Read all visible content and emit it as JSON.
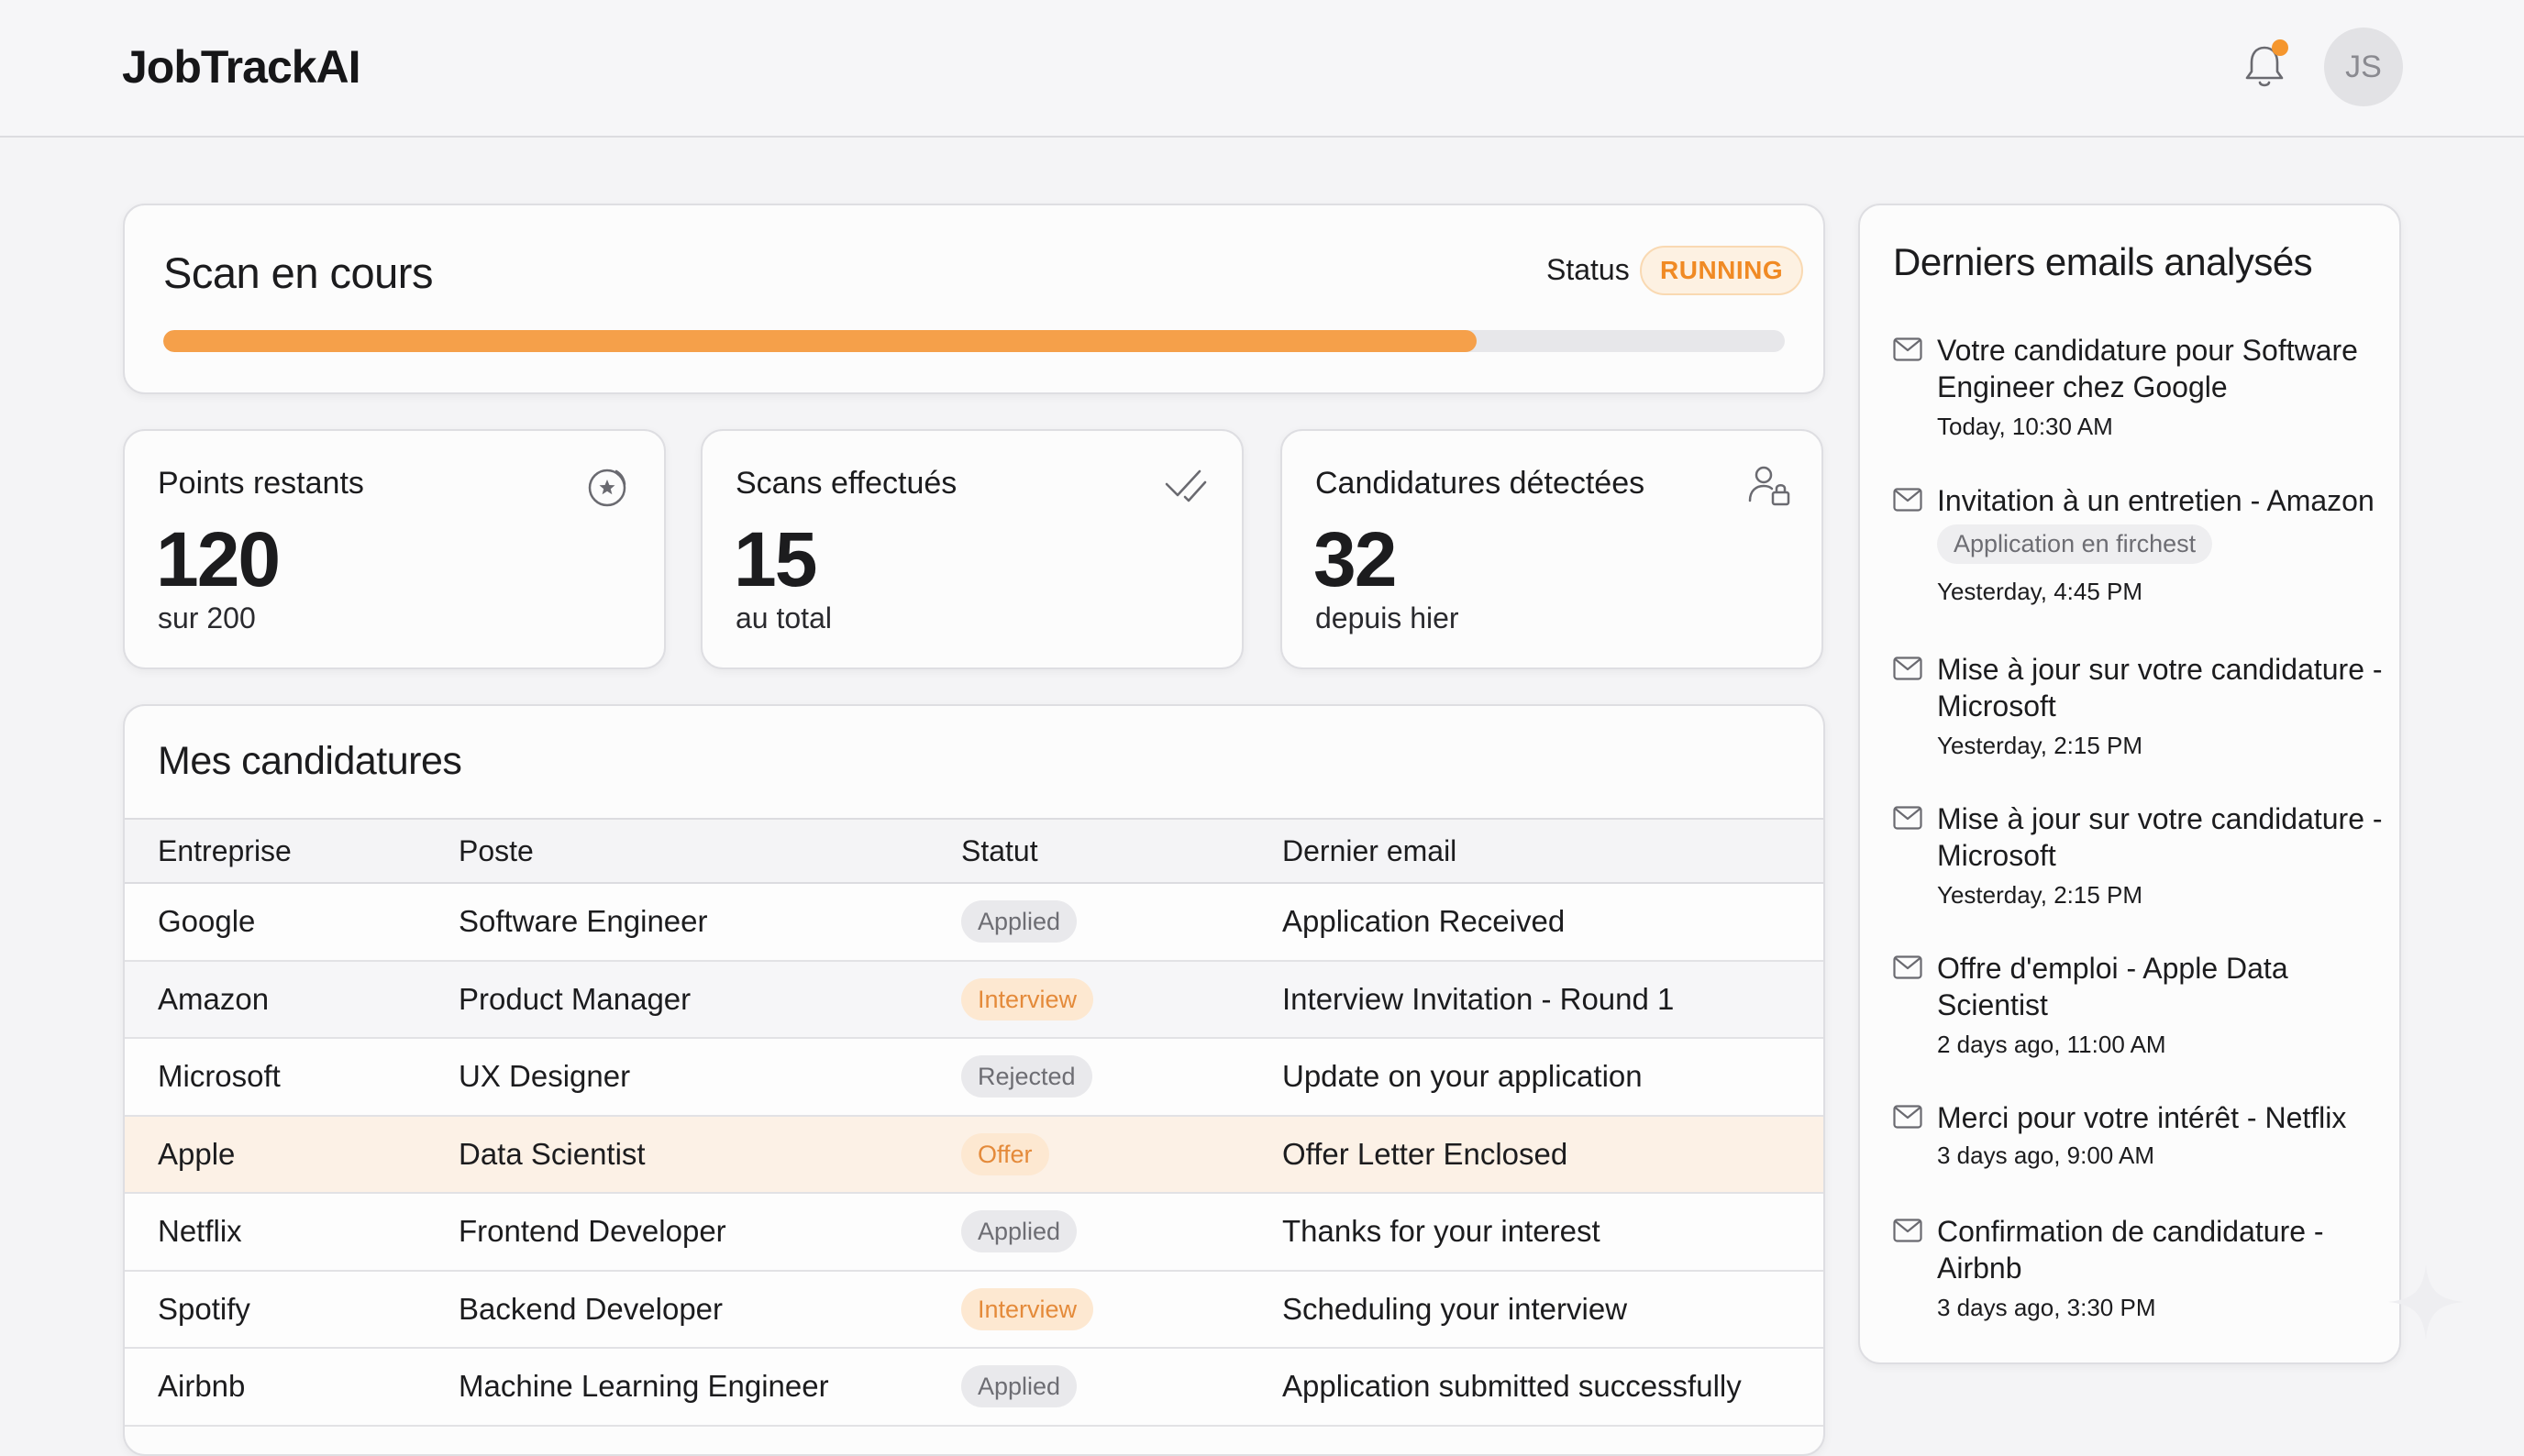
{
  "app": {
    "name": "JobTrackAI"
  },
  "header": {
    "avatar_initials": "JS",
    "notification_indicator_color": "#f5962e"
  },
  "scan": {
    "title": "Scan en cours",
    "status_label": "Status",
    "status_value": "RUNNING",
    "progress_fraction": 0.81,
    "accent_color": "#f5a04a"
  },
  "stats": [
    {
      "label": "Points restants",
      "value": "120",
      "sub": "sur 200",
      "icon": "coin-star-icon"
    },
    {
      "label": "Scans effectués",
      "value": "15",
      "sub": "au total",
      "icon": "double-check-icon"
    },
    {
      "label": "Candidatures détectées",
      "value": "32",
      "sub": "depuis hier",
      "icon": "user-lock-icon"
    }
  ],
  "applications": {
    "title": "Mes candidatures",
    "columns": [
      "Entreprise",
      "Poste",
      "Statut",
      "Dernier email"
    ],
    "rows": [
      {
        "company": "Google",
        "role": "Software Engineer",
        "status": "Applied",
        "last_email": "Application Received"
      },
      {
        "company": "Amazon",
        "role": "Product Manager",
        "status": "Interview",
        "last_email": "Interview Invitation - Round 1"
      },
      {
        "company": "Microsoft",
        "role": "UX Designer",
        "status": "Rejected",
        "last_email": "Update on your application"
      },
      {
        "company": "Apple",
        "role": "Data Scientist",
        "status": "Offer",
        "last_email": "Offer Letter Enclosed"
      },
      {
        "company": "Netflix",
        "role": "Frontend Developer",
        "status": "Applied",
        "last_email": "Thanks for your interest"
      },
      {
        "company": "Spotify",
        "role": "Backend Developer",
        "status": "Interview",
        "last_email": "Scheduling your interview"
      },
      {
        "company": "Airbnb",
        "role": "Machine Learning Engineer",
        "status": "Applied",
        "last_email": "Application submitted successfully"
      }
    ]
  },
  "emails": {
    "title": "Derniers emails analysés",
    "items": [
      {
        "subject": "Votre candidature pour Software Engineer chez Google",
        "tag": "",
        "time": "Today, 10:30 AM"
      },
      {
        "subject": "Invitation à un entretien - Amazon",
        "tag": "Application en firchest",
        "time": "Yesterday, 4:45 PM"
      },
      {
        "subject": "Mise à jour sur votre candidature - Microsoft",
        "tag": "",
        "time": "Yesterday, 2:15 PM"
      },
      {
        "subject": "Mise à jour sur votre candidature - Microsoft",
        "tag": "",
        "time": "Yesterday, 2:15 PM"
      },
      {
        "subject": "Offre d'emploi - Apple Data Scientist",
        "tag": "",
        "time": "2 days ago, 11:00 AM"
      },
      {
        "subject": "Merci pour votre intérêt - Netflix",
        "tag": "",
        "time": "3 days ago, 9:00 AM"
      },
      {
        "subject": "Confirmation de candidature - Airbnb",
        "tag": "",
        "time": "3 days ago, 3:30 PM"
      }
    ]
  }
}
